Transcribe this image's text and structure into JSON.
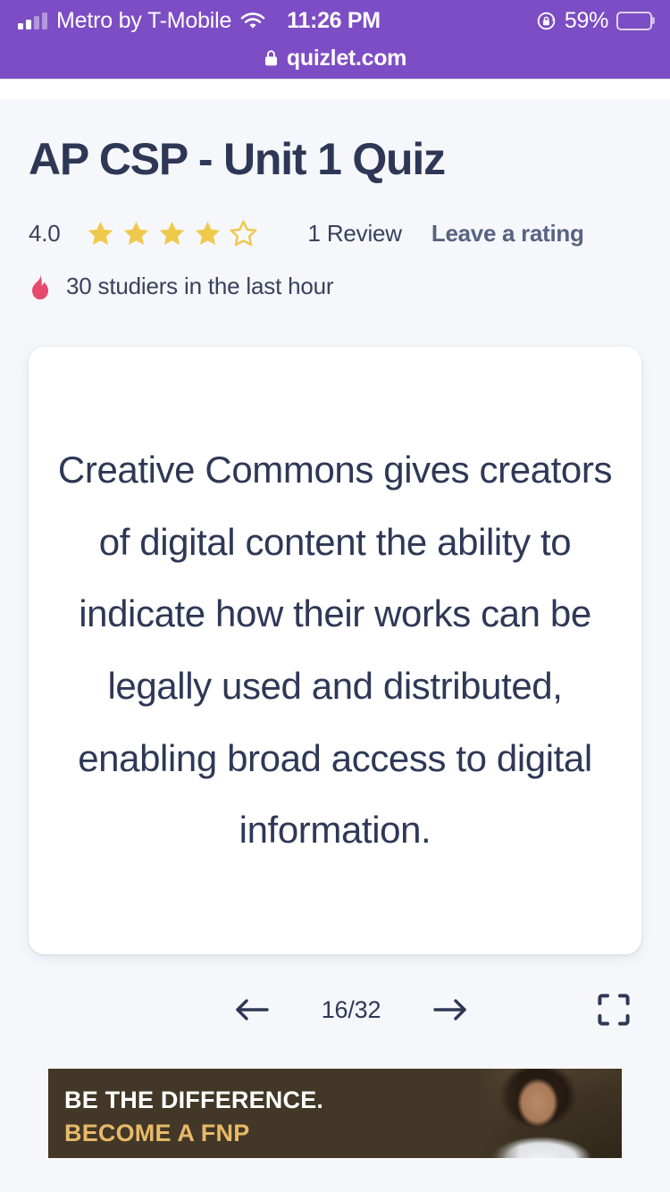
{
  "status_bar": {
    "carrier": "Metro by T-Mobile",
    "wifi_icon": "wifi-icon",
    "signal_icon": "cellular-signal-icon",
    "signal_bars_filled": 2,
    "signal_bars_total": 4,
    "time": "11:26 PM",
    "rotation_lock_icon": "rotation-lock-icon",
    "battery_percent": "59%",
    "battery_level": 59
  },
  "browser": {
    "lock_icon": "lock-icon",
    "url": "quizlet.com"
  },
  "header": {
    "title": "AP CSP - Unit 1 Quiz",
    "rating": {
      "score": "4.0",
      "stars_filled": 4,
      "stars_total": 5,
      "review_count": "1 Review",
      "leave_rating_label": "Leave a rating",
      "star_color": "#efc94c"
    },
    "studiers": {
      "flame_icon": "flame-icon",
      "text": "30 studiers in the last hour",
      "flame_color": "#e64a6e"
    }
  },
  "flashcard": {
    "text": "Creative Commons gives creators of digital content the ability to indicate how their works can be legally used and distributed, enabling broad access to digital information."
  },
  "card_nav": {
    "prev_icon": "arrow-left-icon",
    "counter": "16/32",
    "current_card": 16,
    "total_cards": 32,
    "next_icon": "arrow-right-icon",
    "fullscreen_icon": "fullscreen-expand-icon"
  },
  "ad": {
    "line1": "BE THE DIFFERENCE.",
    "line2": "BECOME A FNP",
    "background_color": "#433828",
    "accent_color": "#e8b968"
  },
  "theme": {
    "browser_chrome": "#7c4dc4",
    "page_background": "#f6f7fb",
    "text_primary": "#2e3856",
    "text_secondary": "#586380",
    "card_background": "#ffffff"
  }
}
